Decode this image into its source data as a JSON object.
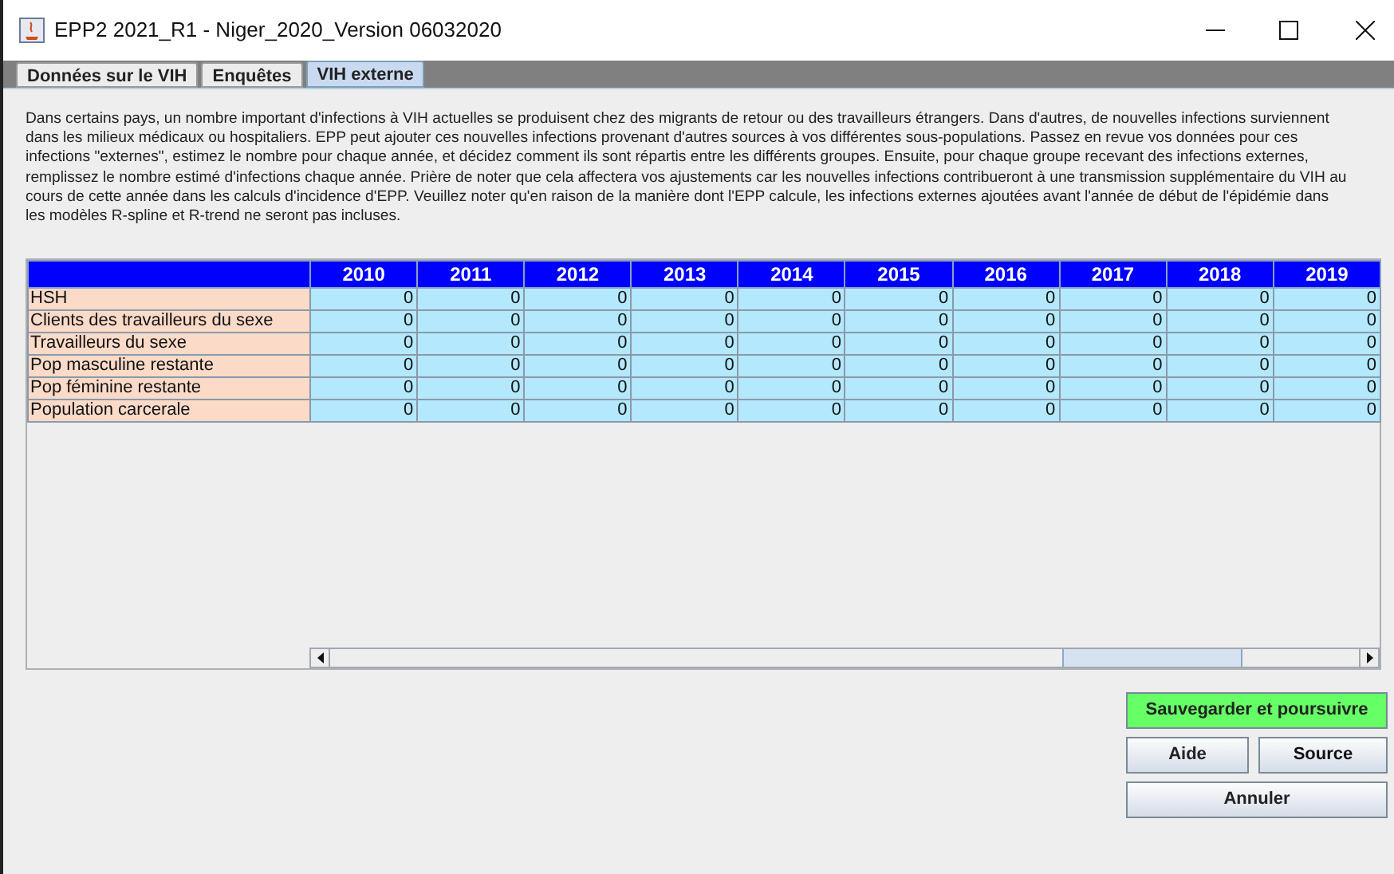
{
  "window": {
    "title": "EPP2 2021_R1 - Niger_2020_Version 06032020"
  },
  "tabs": [
    {
      "label": "Données sur le VIH",
      "selected": false
    },
    {
      "label": "Enquêtes",
      "selected": false
    },
    {
      "label": "VIH externe",
      "selected": true
    }
  ],
  "description": "Dans certains pays, un nombre important d'infections à VIH actuelles se produisent chez des migrants de retour ou des travailleurs étrangers. Dans d'autres, de nouvelles infections surviennent dans les milieux médicaux ou hospitaliers. EPP peut ajouter ces nouvelles infections provenant d'autres sources à vos différentes sous-populations. Passez en revue vos données pour ces infections \"externes\", estimez le nombre pour chaque année, et décidez comment ils sont répartis entre les différents groupes. Ensuite, pour chaque groupe recevant des infections externes, remplissez le nombre estimé d'infections chaque année. Prière de noter que cela affectera vos ajustements car les nouvelles infections contribueront à une transmission supplémentaire du VIH au cours de cette année dans les calculs d'incidence d'EPP. Veuillez noter qu'en raison de la manière dont l'EPP calcule, les infections externes ajoutées avant l'année de début de l'épidémie dans les modèles R-spline et R-trend ne seront pas incluses.",
  "table": {
    "columns": [
      "2010",
      "2011",
      "2012",
      "2013",
      "2014",
      "2015",
      "2016",
      "2017",
      "2018",
      "2019"
    ],
    "rows": [
      {
        "label": "HSH",
        "values": [
          "0",
          "0",
          "0",
          "0",
          "0",
          "0",
          "0",
          "0",
          "0",
          "0"
        ]
      },
      {
        "label": "Clients des travailleurs du sexe",
        "values": [
          "0",
          "0",
          "0",
          "0",
          "0",
          "0",
          "0",
          "0",
          "0",
          "0"
        ]
      },
      {
        "label": "Travailleurs du sexe",
        "values": [
          "0",
          "0",
          "0",
          "0",
          "0",
          "0",
          "0",
          "0",
          "0",
          "0"
        ]
      },
      {
        "label": "Pop masculine restante",
        "values": [
          "0",
          "0",
          "0",
          "0",
          "0",
          "0",
          "0",
          "0",
          "0",
          "0"
        ]
      },
      {
        "label": "Pop féminine restante",
        "values": [
          "0",
          "0",
          "0",
          "0",
          "0",
          "0",
          "0",
          "0",
          "0",
          "0"
        ]
      },
      {
        "label": "Population carcerale",
        "values": [
          "0",
          "0",
          "0",
          "0",
          "0",
          "0",
          "0",
          "0",
          "0",
          "0"
        ]
      }
    ]
  },
  "buttons": {
    "save": "Sauvegarder et poursuivre",
    "help": "Aide",
    "source": "Source",
    "cancel": "Annuler"
  }
}
